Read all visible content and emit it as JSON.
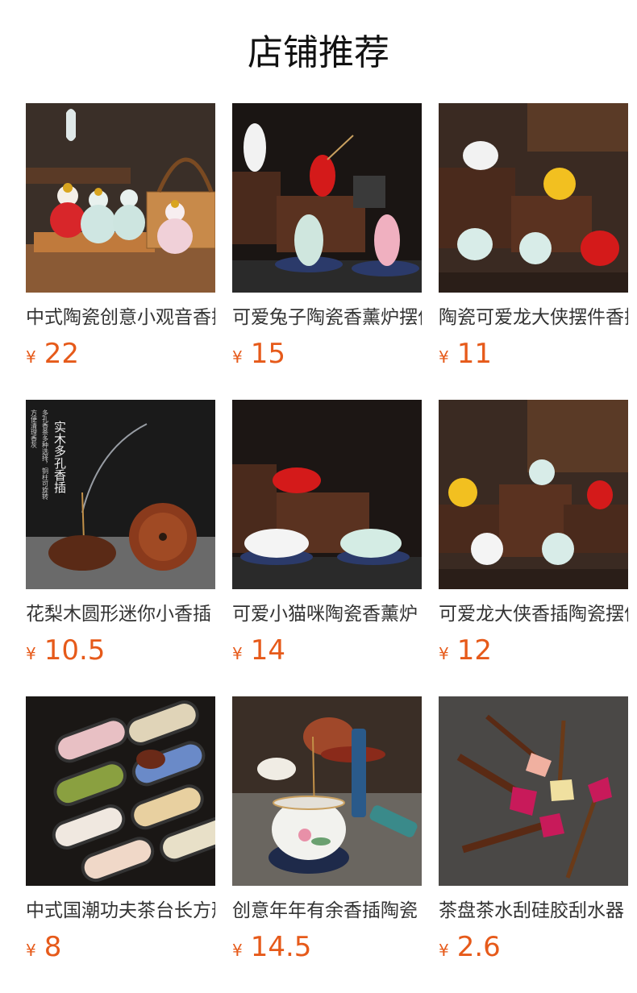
{
  "title": "店铺推荐",
  "currency": "¥",
  "accent_color": "#e65a1a",
  "products": [
    {
      "name": "中式陶瓷创意小观音香插",
      "price": "22"
    },
    {
      "name": "可爱兔子陶瓷香薰炉摆件",
      "price": "15"
    },
    {
      "name": "陶瓷可爱龙大侠摆件香插",
      "price": "11"
    },
    {
      "name": "花梨木圆形迷你小香插",
      "price": "10.5"
    },
    {
      "name": "可爱小猫咪陶瓷香薰炉",
      "price": "14"
    },
    {
      "name": "可爱龙大侠香插陶瓷摆件",
      "price": "12"
    },
    {
      "name": "中式国潮功夫茶台长方形",
      "price": "8"
    },
    {
      "name": "创意年年有余香插陶瓷",
      "price": "14.5"
    },
    {
      "name": "茶盘茶水刮硅胶刮水器",
      "price": "2.6"
    }
  ],
  "image_text": {
    "incense_holder_heading": "实木多孔香插",
    "incense_holder_desc_1": "多孔香茶多种选择，铜柱可旋转",
    "incense_holder_desc_2": "方便清理香灰"
  }
}
